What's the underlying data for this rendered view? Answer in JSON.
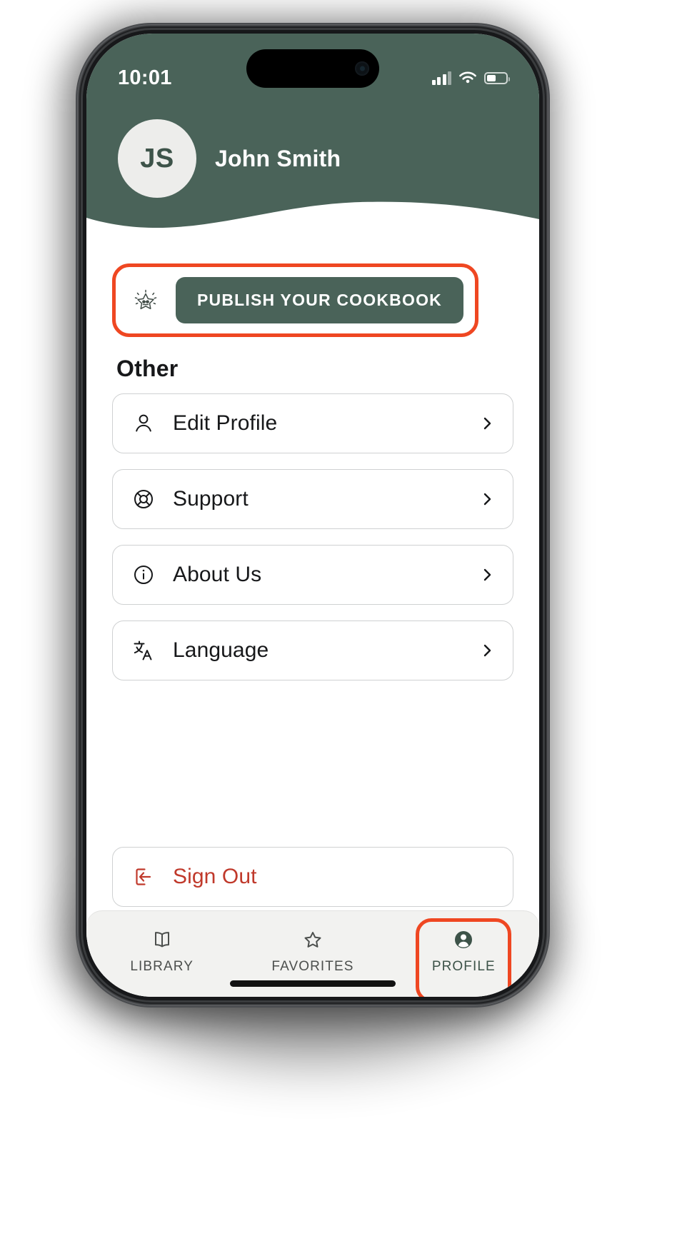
{
  "status_bar": {
    "time": "10:01",
    "signal_icon": "cellular-signal-icon",
    "wifi_icon": "wifi-icon",
    "battery_icon": "battery-icon"
  },
  "header": {
    "avatar_initials": "JS",
    "user_name": "John Smith",
    "background_color": "#4a6359"
  },
  "publish": {
    "icon": "star-badge-icon",
    "button_label": "PUBLISH YOUR COOKBOOK",
    "highlight_color": "#ef4722",
    "button_color": "#4a6359"
  },
  "section": {
    "title": "Other"
  },
  "menu": {
    "items": [
      {
        "label": "Edit Profile",
        "icon": "user-icon",
        "chevron": "chevron-right-icon"
      },
      {
        "label": "Support",
        "icon": "lifebuoy-icon",
        "chevron": "chevron-right-icon"
      },
      {
        "label": "About Us",
        "icon": "info-circle-icon",
        "chevron": "chevron-right-icon"
      },
      {
        "label": "Language",
        "icon": "translate-icon",
        "chevron": "chevron-right-icon"
      }
    ]
  },
  "sign_out": {
    "label": "Sign Out",
    "icon": "logout-icon",
    "color": "#c0392b"
  },
  "tab_bar": {
    "tabs": [
      {
        "label": "LIBRARY",
        "icon": "book-icon",
        "active": false,
        "highlighted": false
      },
      {
        "label": "FAVORITES",
        "icon": "star-icon",
        "active": false,
        "highlighted": false
      },
      {
        "label": "PROFILE",
        "icon": "profile-filled-icon",
        "active": true,
        "highlighted": true
      }
    ]
  }
}
